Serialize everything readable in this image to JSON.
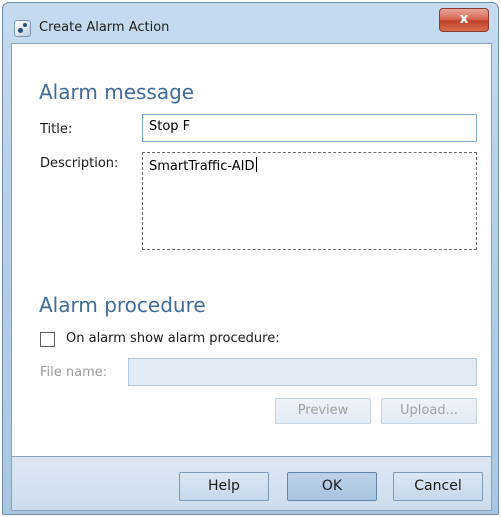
{
  "window": {
    "title": "Create Alarm Action",
    "close_glyph": "x"
  },
  "alarm_message": {
    "heading": "Alarm message",
    "title_label": "Title:",
    "title_value": "Stop F",
    "description_label": "Description:",
    "description_value": "SmartTraffic-AID"
  },
  "alarm_procedure": {
    "heading": "Alarm procedure",
    "checkbox_label": "On alarm show alarm procedure:",
    "checkbox_checked": false,
    "file_name_label": "File name:",
    "file_name_value": "",
    "preview_label": "Preview",
    "upload_label": "Upload..."
  },
  "footer": {
    "help_label": "Help",
    "ok_label": "OK",
    "cancel_label": "Cancel"
  },
  "icons": {
    "app": "alarm-action-icon",
    "close": "close-icon"
  },
  "colors": {
    "heading": "#3e6c9a",
    "titlebar": "#b6cfe7",
    "close_button": "#c1412a",
    "disabled_text": "#9a9a9a"
  }
}
